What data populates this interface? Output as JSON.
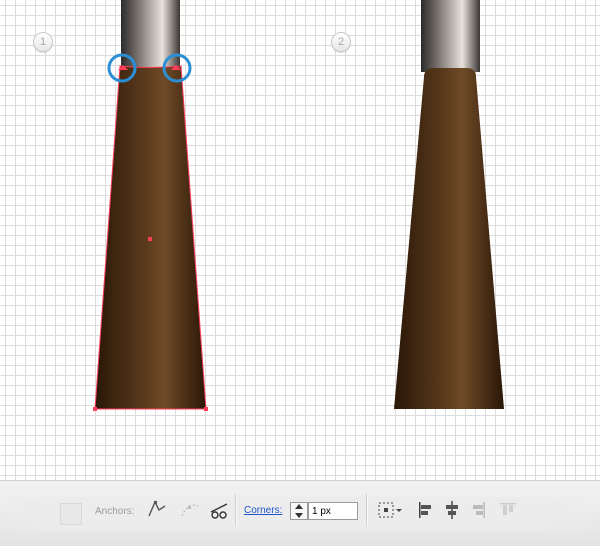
{
  "steps": [
    {
      "number": "1"
    },
    {
      "number": "2"
    }
  ],
  "colors": {
    "grid_line": "#dcdcdc",
    "handle_dark": "#2b2b2b",
    "handle_light": "#d8d1ca",
    "body_dark": "#2a1707",
    "body_light": "#6f4a27",
    "selection": "#ff3c5a",
    "highlight_ring": "#2b8fd6",
    "link_blue": "#1f55c9"
  },
  "control_bar": {
    "anchors_label": "Anchors:",
    "corners_label": "Corners:",
    "corners_value": "1 px",
    "icons": [
      "convert-anchor-corner-icon",
      "convert-anchor-smooth-icon",
      "cut-path-icon",
      "transform-reference-icon",
      "align-left-icon",
      "align-center-icon",
      "align-right-icon",
      "align-top-icon"
    ]
  }
}
